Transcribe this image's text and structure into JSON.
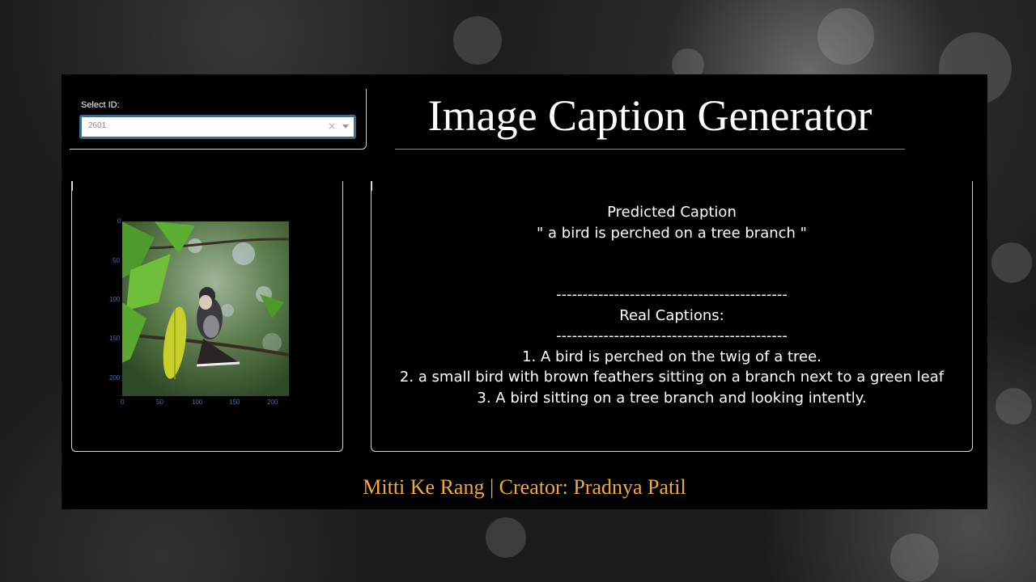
{
  "header": {
    "title": "Image Caption Generator"
  },
  "selector": {
    "label": "Select ID:",
    "value": "2601",
    "clear_glyph": "×"
  },
  "image_plot": {
    "x_ticks": [
      "0",
      "50",
      "100",
      "150",
      "200"
    ],
    "y_ticks": [
      "0",
      "50",
      "100",
      "150",
      "200"
    ]
  },
  "captions": {
    "predicted_heading": "Predicted Caption",
    "predicted_text": "\" a bird is perched on a tree branch \"",
    "divider": "--------------------------------------------",
    "real_heading": "Real Captions:",
    "real": [
      "1. A bird is perched on the twig of a tree.",
      "2. a small bird with brown feathers sitting on a branch next to a green leaf",
      "3. A bird sitting on a tree branch and looking intently."
    ]
  },
  "footer": {
    "text": "Mitti Ke Rang | Creator: Pradnya Patil"
  },
  "colors": {
    "footer_text": "#f2a93b",
    "tick_text": "#4a6fa5",
    "select_border": "#3b6d8f"
  }
}
